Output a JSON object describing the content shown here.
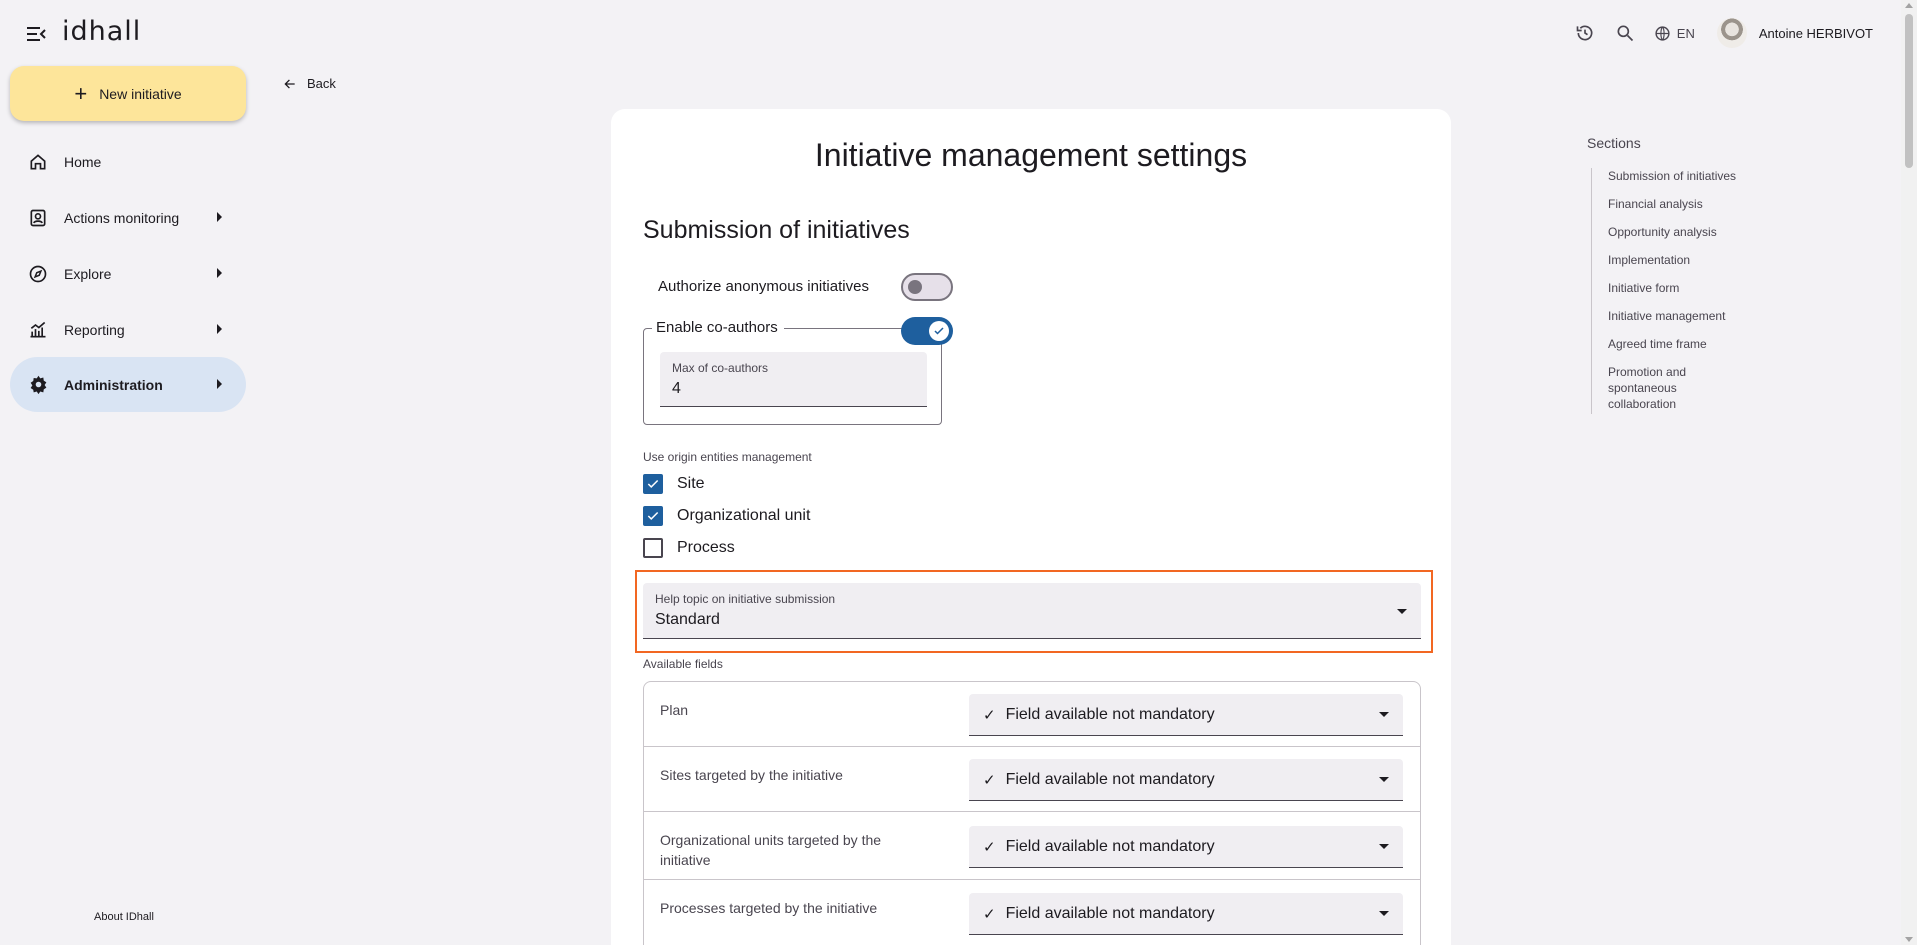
{
  "app": {
    "logo_text": "idhall",
    "menu_icon": "menu-collapse-icon"
  },
  "topbar": {
    "history_icon": "history-icon",
    "search_icon": "search-icon",
    "language": "EN",
    "user_name": "Antoine HERBIVOT"
  },
  "sidebar": {
    "new_initiative_label": "New initiative",
    "items": [
      {
        "label": "Home",
        "icon": "home-icon",
        "has_submenu": false,
        "active": false
      },
      {
        "label": "Actions monitoring",
        "icon": "clipboard-user-icon",
        "has_submenu": true,
        "active": false
      },
      {
        "label": "Explore",
        "icon": "compass-icon",
        "has_submenu": true,
        "active": false
      },
      {
        "label": "Reporting",
        "icon": "chart-icon",
        "has_submenu": true,
        "active": false
      },
      {
        "label": "Administration",
        "icon": "gear-icon",
        "has_submenu": true,
        "active": true
      }
    ],
    "about_label": "About IDhall"
  },
  "back_label": "Back",
  "main": {
    "title": "Initiative management settings",
    "section_title": "Submission of initiatives",
    "anonymous_label": "Authorize anonymous initiatives",
    "anonymous_enabled": false,
    "coauthors_label": "Enable co-authors",
    "coauthors_enabled": true,
    "max_coauthors_label": "Max of co-authors",
    "max_coauthors_value": "4",
    "origin_entities_label": "Use origin entities management",
    "origin_entities": [
      {
        "label": "Site",
        "checked": true
      },
      {
        "label": "Organizational unit",
        "checked": true
      },
      {
        "label": "Process",
        "checked": false
      }
    ],
    "help_topic_label": "Help topic on initiative submission",
    "help_topic_value": "Standard",
    "available_fields_label": "Available fields",
    "fields": [
      {
        "name": "Plan",
        "value": "Field available not mandatory"
      },
      {
        "name": "Sites targeted by the initiative",
        "value": "Field available not mandatory"
      },
      {
        "name": "Organizational units targeted by the initiative",
        "value": "Field available not mandatory"
      },
      {
        "name": "Processes targeted by the initiative",
        "value": "Field available not mandatory"
      }
    ]
  },
  "sections_nav": {
    "title": "Sections",
    "items": [
      "Submission of initiatives",
      "Financial analysis",
      "Opportunity analysis",
      "Implementation",
      "Initiative form",
      "Initiative management",
      "Agreed time frame",
      "Promotion and spontaneous collaboration"
    ]
  },
  "colors": {
    "accent": "#1e5f9e",
    "new_button": "#fde59a",
    "active_nav": "#d9e4f3",
    "highlight": "#f26722"
  }
}
